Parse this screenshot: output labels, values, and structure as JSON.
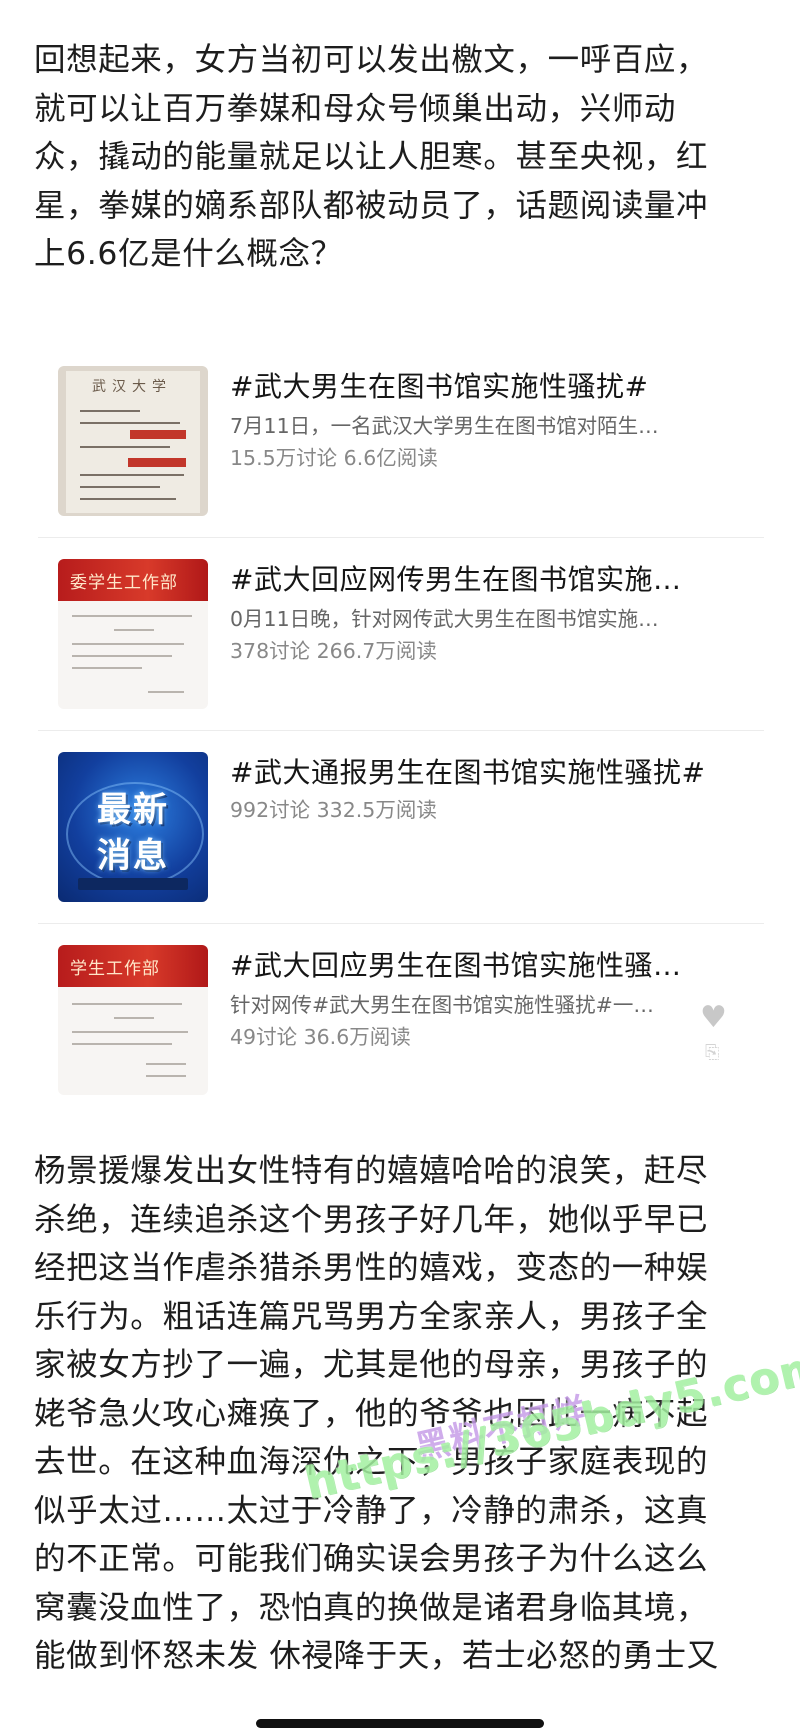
{
  "article": {
    "para1": [
      "回想起来，女方当初可以发出檄文，一呼百应，",
      "就可以让百万拳媒和母众号倾巢出动，兴师动",
      "众，撬动的能量就足以让人胆寒。甚至央视，红",
      "星，拳媒的嫡系部队都被动员了，话题阅读量冲",
      "上6.6亿是什么概念？"
    ],
    "para2": [
      "杨景援爆发出女性特有的嬉嬉哈哈的浪笑，赶尽",
      "杀绝，连续追杀这个男孩子好几年，她似乎早已",
      "经把这当作虐杀猎杀男性的嬉戏，变态的一种娱",
      "乐行为。粗话连篇咒骂男方全家亲人，男孩子全",
      "家被女方抄了一遍，尤其是他的母亲，男孩子的",
      "姥爷急火攻心瘫痪了，他的爷爷也因此一病不起",
      "去世。在这种血海深仇之下，男孩子家庭表现的",
      "似乎太过……太过于冷静了，冷静的肃杀，这真",
      "的不正常。可能我们确实误会男孩子为什么这么",
      "窝囊没血性了，恐怕真的换做是诸君身临其境，",
      "能做到怀怒未发 休祲降于天，若士必怒的勇士又"
    ]
  },
  "topics": [
    {
      "title": "#武大男生在图书馆实施性骚扰#",
      "subtitle": "7月11日，一名武汉大学男生在图书馆对陌生…",
      "stats": "15.5万讨论 6.6亿阅读",
      "thumb_icon": "letter-document-thumbnail"
    },
    {
      "title": "#武大回应网传男生在图书馆实施…",
      "subtitle": "0月11日晚，针对网传武大男生在图书馆实施…",
      "stats": "378讨论 266.7万阅读",
      "thumb_icon": "office-notice-thumbnail",
      "thumb_banner": "委学生工作部"
    },
    {
      "title": "#武大通报男生在图书馆实施性骚扰#",
      "subtitle": "",
      "stats": "992讨论 332.5万阅读",
      "thumb_icon": "breaking-news-thumbnail",
      "thumb_words": [
        "最新",
        "消息"
      ]
    },
    {
      "title": "#武大回应男生在图书馆实施性骚…",
      "subtitle": "针对网传#武大男生在图书馆实施性骚扰#一…",
      "stats": "49讨论 36.6万阅读",
      "thumb_icon": "office-notice-thumbnail",
      "thumb_banner": "学生工作部"
    }
  ],
  "watermark": {
    "line1": "黑料不打烊",
    "line2": "https://365bdy5.com"
  },
  "colors": {
    "text": "#1d1d1d",
    "meta": "#888888",
    "banner_red": "#c62828",
    "news_blue": "#1a4fb8",
    "watermark_green": "#a3f0a0"
  }
}
